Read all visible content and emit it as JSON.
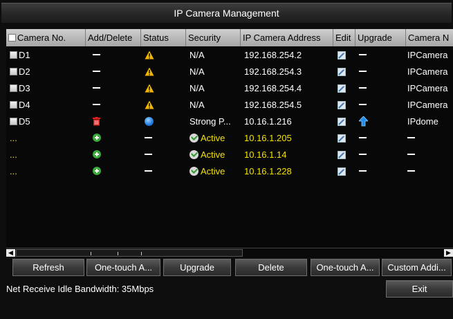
{
  "window": {
    "title": "IP Camera Management"
  },
  "columns": [
    "Camera No.",
    "Add/Delete",
    "Status",
    "Security",
    "IP Camera Address",
    "Edit",
    "Upgrade",
    "Camera N"
  ],
  "rows": [
    {
      "camera_no": "D1",
      "add_delete": "dash",
      "status": "warning",
      "security": "N/A",
      "address": "192.168.254.2",
      "edit": "edit",
      "upgrade": "dash",
      "camera_name": "IPCamera",
      "style": "white",
      "checkbox": true
    },
    {
      "camera_no": "D2",
      "add_delete": "dash",
      "status": "warning",
      "security": "N/A",
      "address": "192.168.254.3",
      "edit": "edit",
      "upgrade": "dash",
      "camera_name": "IPCamera",
      "style": "white",
      "checkbox": true
    },
    {
      "camera_no": "D3",
      "add_delete": "dash",
      "status": "warning",
      "security": "N/A",
      "address": "192.168.254.4",
      "edit": "edit",
      "upgrade": "dash",
      "camera_name": "IPCamera",
      "style": "white",
      "checkbox": true
    },
    {
      "camera_no": "D4",
      "add_delete": "dash",
      "status": "warning",
      "security": "N/A",
      "address": "192.168.254.5",
      "edit": "edit",
      "upgrade": "dash",
      "camera_name": "IPCamera",
      "style": "white",
      "checkbox": true
    },
    {
      "camera_no": "D5",
      "add_delete": "delete",
      "status": "online",
      "security": "Strong P...",
      "address": "10.16.1.216",
      "edit": "edit",
      "upgrade": "upgrade",
      "camera_name": "IPdome",
      "style": "white",
      "checkbox": true
    },
    {
      "camera_no": "...",
      "add_delete": "add",
      "status": "dash",
      "security": "Active",
      "address": "10.16.1.205",
      "edit": "edit",
      "upgrade": "dash",
      "camera_name": "dash",
      "style": "yellow",
      "checkbox": false
    },
    {
      "camera_no": "...",
      "add_delete": "add",
      "status": "dash",
      "security": "Active",
      "address": "10.16.1.14",
      "edit": "edit",
      "upgrade": "dash",
      "camera_name": "dash",
      "style": "yellow",
      "checkbox": false
    },
    {
      "camera_no": "...",
      "add_delete": "add",
      "status": "dash",
      "security": "Active",
      "address": "10.16.1.228",
      "edit": "edit",
      "upgrade": "dash",
      "camera_name": "dash",
      "style": "yellow",
      "checkbox": false
    }
  ],
  "buttons": {
    "refresh": "Refresh",
    "one_touch_activate": "One-touch A...",
    "upgrade": "Upgrade",
    "delete": "Delete",
    "one_touch_adding": "One-touch A...",
    "custom_adding": "Custom Addi..."
  },
  "status_bar": {
    "bandwidth": "Net Receive Idle Bandwidth: 35Mbps"
  },
  "exit_label": "Exit",
  "colors": {
    "active_text": "#f5e200",
    "warning": "#f3b800",
    "delete_icon": "#e02020",
    "add_icon": "#3cab3c"
  }
}
